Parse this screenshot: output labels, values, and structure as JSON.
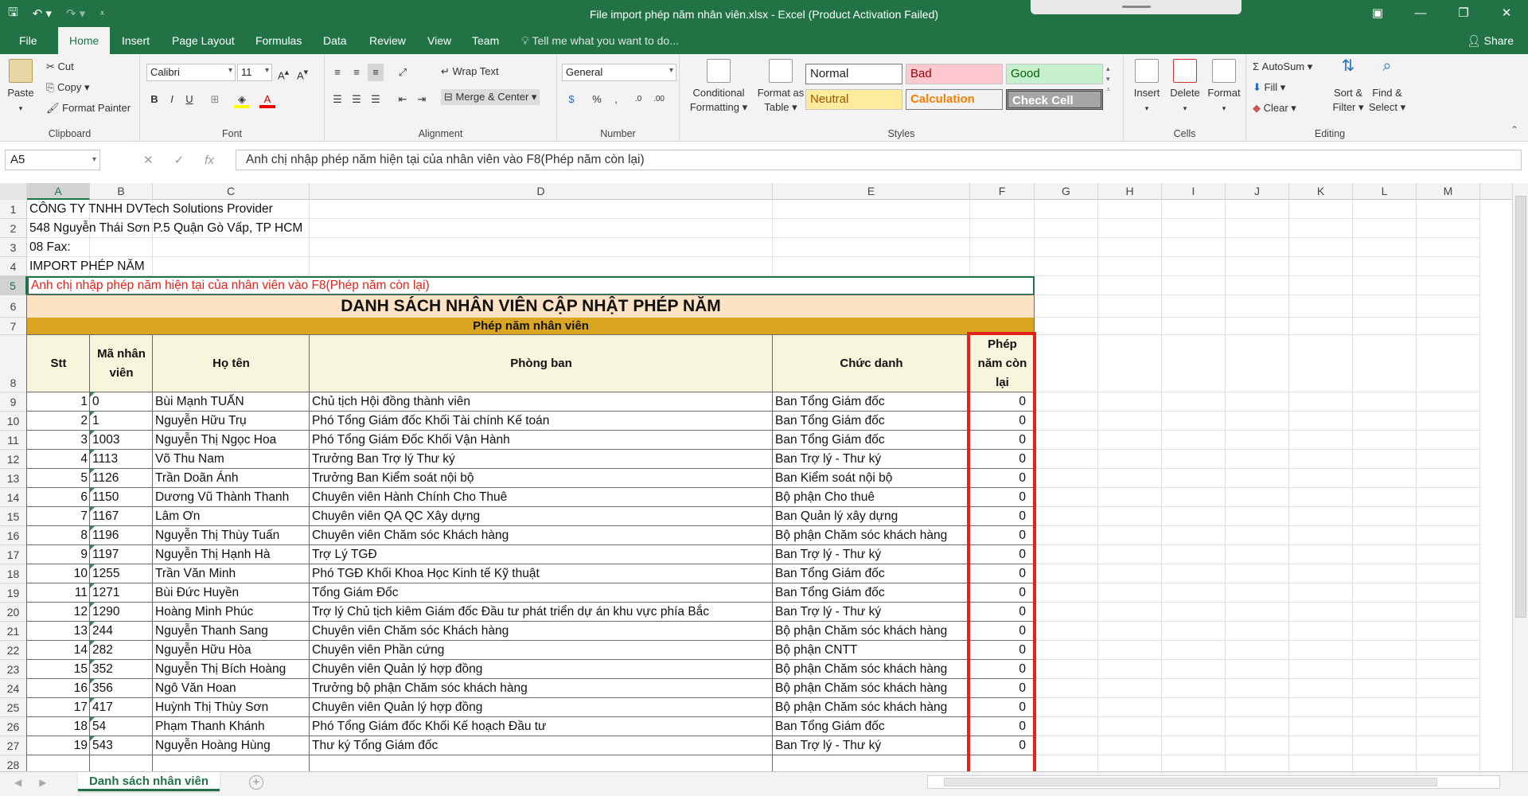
{
  "window": {
    "title": "File import phép năm nhân viên.xlsx - Excel (Product Activation Failed)"
  },
  "ribbon_tabs": [
    "File",
    "Home",
    "Insert",
    "Page Layout",
    "Formulas",
    "Data",
    "Review",
    "View",
    "Team"
  ],
  "tell_me": "Tell me what you want to do...",
  "share": "Share",
  "clipboard": {
    "paste": "Paste",
    "cut": "Cut",
    "copy": "Copy",
    "format_painter": "Format Painter",
    "label": "Clipboard"
  },
  "font": {
    "name": "Calibri",
    "size": "11",
    "label": "Font"
  },
  "alignment": {
    "wrap": "Wrap Text",
    "merge": "Merge & Center",
    "label": "Alignment"
  },
  "number": {
    "format": "General",
    "label": "Number"
  },
  "styles": {
    "conditional": "Conditional Formatting",
    "format_table": "Format as Table",
    "normal": "Normal",
    "bad": "Bad",
    "good": "Good",
    "neutral": "Neutral",
    "calculation": "Calculation",
    "check_cell": "Check Cell",
    "label": "Styles"
  },
  "cells_group": {
    "insert": "Insert",
    "delete": "Delete",
    "format": "Format",
    "label": "Cells"
  },
  "editing": {
    "autosum": "AutoSum",
    "fill": "Fill",
    "clear": "Clear",
    "sort": "Sort & Filter",
    "find": "Find & Select",
    "label": "Editing"
  },
  "formula_bar": {
    "name_box": "A5",
    "formula": "Anh chị nhập phép năm hiện tại của nhân viên vào F8(Phép năm còn lại)"
  },
  "columns": [
    "A",
    "B",
    "C",
    "D",
    "E",
    "F",
    "G",
    "H",
    "I",
    "J",
    "K",
    "L",
    "M"
  ],
  "rows": [
    "1",
    "2",
    "3",
    "4",
    "5",
    "6",
    "7",
    "8",
    "9",
    "10",
    "11",
    "12",
    "13",
    "14",
    "15",
    "16",
    "17",
    "18",
    "19",
    "20",
    "21",
    "22",
    "23",
    "24",
    "25",
    "26",
    "27",
    "28"
  ],
  "sheet": {
    "line1": "CÔNG TY TNHH DVTech Solutions Provider",
    "line2": "548 Nguyễn Thái Sơn P.5 Quận Gò Vấp, TP HCM",
    "line3": "08 Fax:",
    "line4": "IMPORT PHÉP NĂM",
    "line5": "Anh chị nhập phép năm hiện tại của nhân viên vào F8(Phép năm còn lại)",
    "title": "DANH SÁCH NHÂN VIÊN CẬP NHẬT PHÉP NĂM",
    "subtitle": "Phép năm nhân viên",
    "headers": {
      "stt": "Stt",
      "ma_nv": "Mã nhân viên",
      "ho_ten": "Họ tên",
      "phong_ban": "Phòng ban",
      "chuc_danh": "Chức danh",
      "phep": "Phép năm còn lại"
    },
    "employees": [
      {
        "stt": "1",
        "ma": "0",
        "ten": "Bùi Mạnh TUẤN",
        "phong": "Chủ tịch Hội đồng thành viên",
        "chuc": "Ban Tổng Giám đốc",
        "phep": "0"
      },
      {
        "stt": "2",
        "ma": "1",
        "ten": "Nguyễn Hữu Trụ",
        "phong": "Phó Tổng Giám đốc Khối Tài chính Kế toán",
        "chuc": "Ban Tổng Giám đốc",
        "phep": "0"
      },
      {
        "stt": "3",
        "ma": "1003",
        "ten": "Nguyễn Thị Ngọc Hoa",
        "phong": "Phó Tổng Giám Đốc Khối Vận Hành",
        "chuc": "Ban Tổng Giám đốc",
        "phep": "0"
      },
      {
        "stt": "4",
        "ma": "1113",
        "ten": "Võ Thu Nam",
        "phong": "Trưởng Ban Trợ lý Thư ký",
        "chuc": "Ban Trợ lý - Thư ký",
        "phep": "0"
      },
      {
        "stt": "5",
        "ma": "1126",
        "ten": "Trần Doãn Ánh",
        "phong": "Trưởng Ban Kiểm soát nội bộ",
        "chuc": "Ban Kiểm soát nội bộ",
        "phep": "0"
      },
      {
        "stt": "6",
        "ma": "1150",
        "ten": "Dương Vũ Thành Thanh",
        "phong": "Chuyên viên Hành Chính Cho Thuê",
        "chuc": "Bộ phận Cho thuê",
        "phep": "0"
      },
      {
        "stt": "7",
        "ma": "1167",
        "ten": "Lâm Ơn",
        "phong": "Chuyên viên QA QC Xây dựng",
        "chuc": "Ban Quản lý xây dựng",
        "phep": "0"
      },
      {
        "stt": "8",
        "ma": "1196",
        "ten": "Nguyễn Thị Thùy Tuấn",
        "phong": "Chuyên viên Chăm sóc Khách hàng",
        "chuc": "Bộ phận Chăm sóc khách hàng",
        "phep": "0"
      },
      {
        "stt": "9",
        "ma": "1197",
        "ten": "Nguyễn Thị Hạnh Hà",
        "phong": "Trợ Lý TGĐ",
        "chuc": "Ban Trợ lý - Thư ký",
        "phep": "0"
      },
      {
        "stt": "10",
        "ma": "1255",
        "ten": "Trần Văn Minh",
        "phong": "Phó TGĐ Khối Khoa Học Kinh tế Kỹ thuật",
        "chuc": "Ban Tổng Giám đốc",
        "phep": "0"
      },
      {
        "stt": "11",
        "ma": "1271",
        "ten": "Bùi Đức Huyền",
        "phong": "Tổng Giám Đốc",
        "chuc": "Ban Tổng Giám đốc",
        "phep": "0"
      },
      {
        "stt": "12",
        "ma": "1290",
        "ten": "Hoàng Minh Phúc",
        "phong": "Trợ lý Chủ tịch kiêm Giám đốc Đầu tư phát triển dự án khu vực phía Bắc",
        "chuc": "Ban Trợ lý - Thư ký",
        "phep": "0"
      },
      {
        "stt": "13",
        "ma": "244",
        "ten": "Nguyễn Thanh Sang",
        "phong": "Chuyên viên Chăm sóc Khách hàng",
        "chuc": "Bộ phận Chăm sóc khách hàng",
        "phep": "0"
      },
      {
        "stt": "14",
        "ma": "282",
        "ten": "Nguyễn Hữu Hòa",
        "phong": "Chuyên viên Phần cứng",
        "chuc": "Bộ phận CNTT",
        "phep": "0"
      },
      {
        "stt": "15",
        "ma": "352",
        "ten": "Nguyễn Thị Bích Hoàng",
        "phong": "Chuyên viên Quản lý hợp đồng",
        "chuc": "Bộ phận Chăm sóc khách hàng",
        "phep": "0"
      },
      {
        "stt": "16",
        "ma": "356",
        "ten": "Ngô Văn Hoan",
        "phong": "Trưởng bộ phận Chăm sóc khách hàng",
        "chuc": "Bộ phận Chăm sóc khách hàng",
        "phep": "0"
      },
      {
        "stt": "17",
        "ma": "417",
        "ten": "Huỳnh Thị Thùy Sơn",
        "phong": "Chuyên viên Quản lý hợp đồng",
        "chuc": "Bộ phận Chăm sóc khách hàng",
        "phep": "0"
      },
      {
        "stt": "18",
        "ma": "54",
        "ten": "Phạm Thanh Khánh",
        "phong": "Phó Tổng Giám đốc Khối Kế hoạch Đầu tư",
        "chuc": "Ban Tổng Giám đốc",
        "phep": "0"
      },
      {
        "stt": "19",
        "ma": "543",
        "ten": "Nguyễn Hoàng Hùng",
        "phong": "Thư ký Tổng Giám đốc",
        "chuc": "Ban Trợ lý - Thư ký",
        "phep": "0"
      }
    ]
  },
  "sheet_tab": "Danh sách nhân viên",
  "colors": {
    "excel_green": "#217346",
    "title_fill": "#fde2c4",
    "subtitle_fill": "#daa520",
    "header_fill": "#f7f5dc",
    "red_note": "#e2231a",
    "highlight": "#e2231a"
  }
}
